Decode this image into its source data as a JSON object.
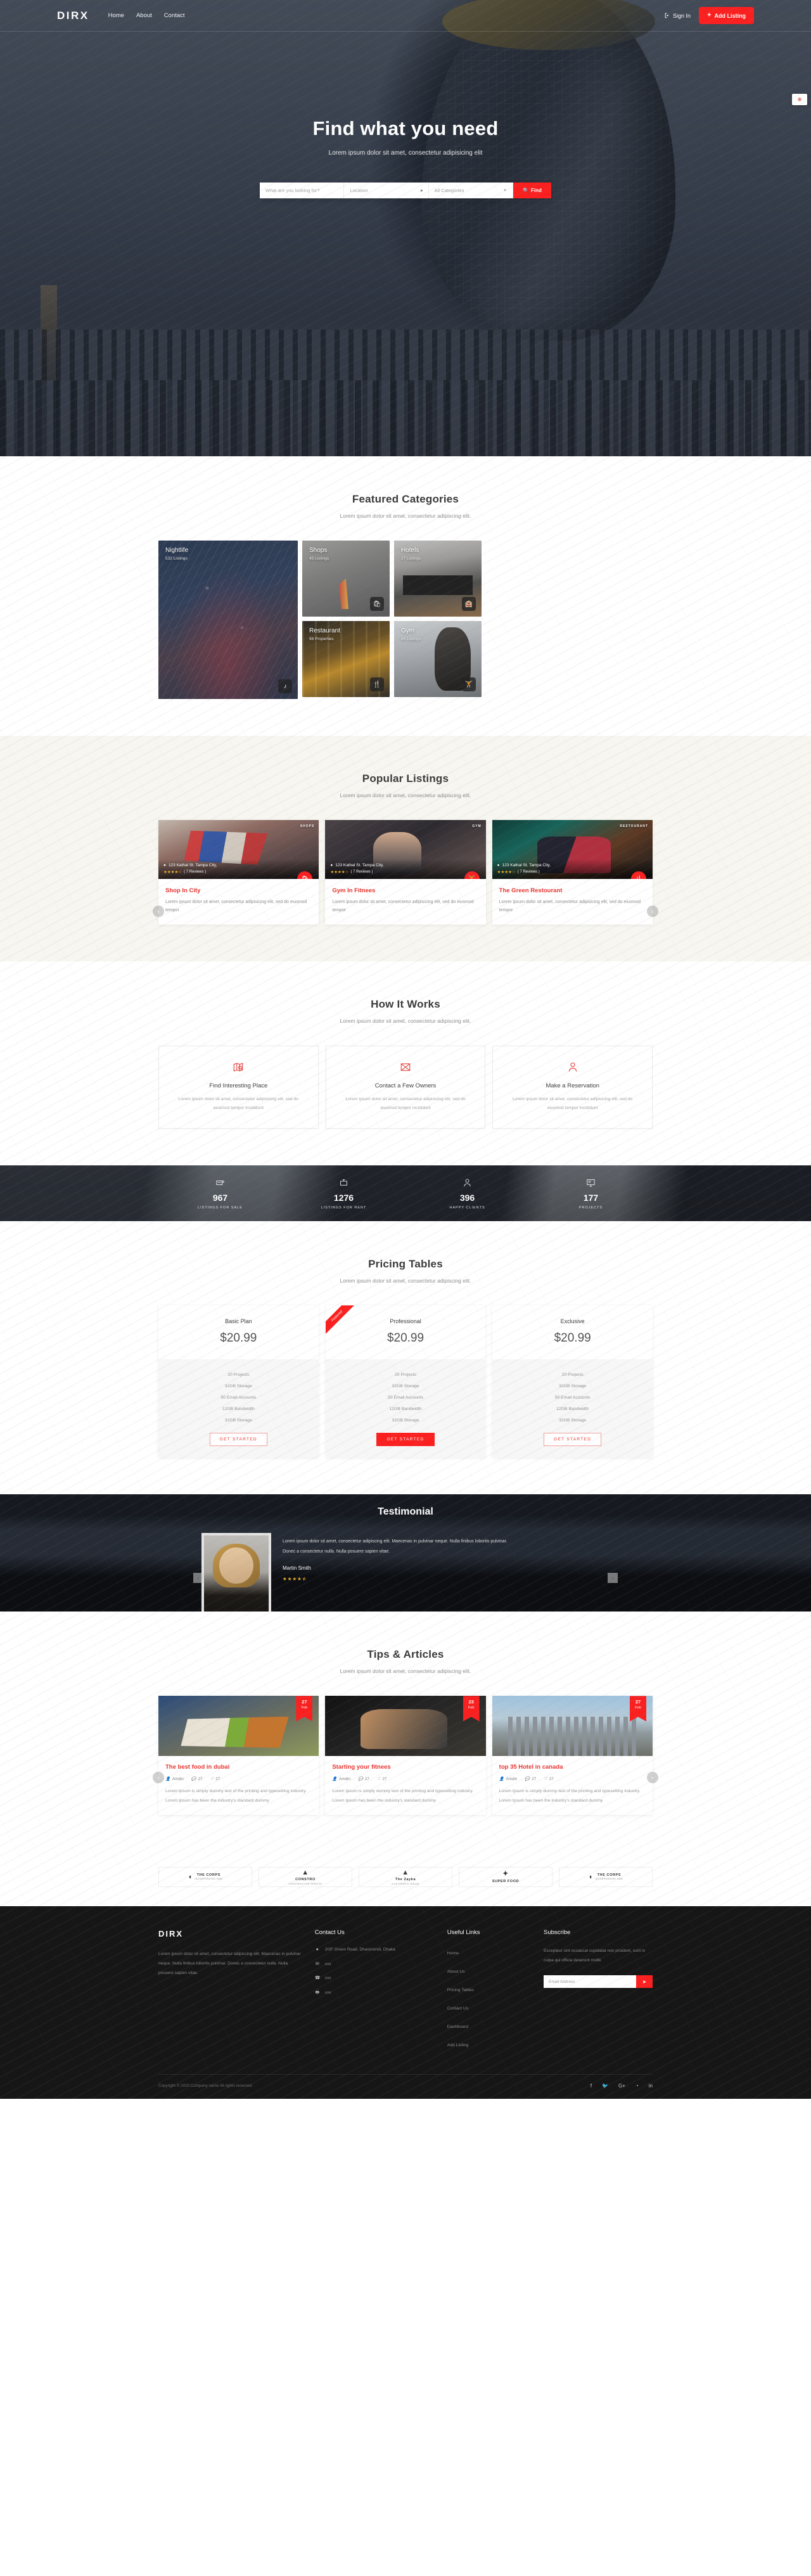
{
  "nav": {
    "logo": "DIRX",
    "links": [
      "Home",
      "About",
      "Contact"
    ],
    "sign_in": "Sign In",
    "add_listing": "Add Listing"
  },
  "hero": {
    "title": "Find what you need",
    "subtitle": "Lorem ipsum dolor sit amet, consectetur adipisicing elit",
    "search_placeholder": "What are you looking for?",
    "location_placeholder": "Location",
    "category_value": "All Categories",
    "find_label": "Find"
  },
  "featured": {
    "title": "Featured Categories",
    "subtitle": "Lorem ipsum dolor sit amet, consectetur adipiscing elit.",
    "items": [
      {
        "name": "Nightlife",
        "count": "532 Listings",
        "icon": "music-icon"
      },
      {
        "name": "Shops",
        "count": "45 Listings",
        "icon": "shopping-bag-icon"
      },
      {
        "name": "Hotels",
        "count": "27 Listings",
        "icon": "hotel-icon"
      },
      {
        "name": "Restaurant",
        "count": "98 Properties",
        "icon": "restaurant-icon"
      },
      {
        "name": "Gym",
        "count": "85 Listings",
        "icon": "gym-icon"
      }
    ]
  },
  "popular": {
    "title": "Popular Listings",
    "subtitle": "Lorem ipsum dolor sit amet, consectetur adipiscing elit.",
    "prev": "‹",
    "next": "›",
    "items": [
      {
        "tag": "SHOPS",
        "address": "123 Kathal St. Tampa City,",
        "stars": "★★★★☆",
        "reviews": "( 7 Reviews )",
        "title": "Shop In City",
        "desc": "Lorem ipsum dolor sit amet, consectetur adipisicing elit, sed do eiusmod tempor",
        "badge_icon": "shopping-bag-icon"
      },
      {
        "tag": "GYM",
        "address": "123 Kathal St. Tampa City,",
        "stars": "★★★★☆",
        "reviews": "( 7 Reviews )",
        "title": "Gym In Fitnees",
        "desc": "Lorem ipsum dolor sit amet, consectetur adipisicing elit, sed do eiusmod tempor",
        "badge_icon": "gym-icon"
      },
      {
        "tag": "RESTOURANT",
        "address": "123 Kathal St. Tampa City,",
        "stars": "★★★★☆",
        "reviews": "( 7 Reviews )",
        "title": "The Green Restourant",
        "desc": "Lorem ipsum dolor sit amet, consectetur adipisicing elit, sed do eiusmod tempor",
        "badge_icon": "restaurant-icon"
      }
    ]
  },
  "how": {
    "title": "How It Works",
    "subtitle": "Lorem ipsum dolor sit amet, consectetur adipiscing elit.",
    "items": [
      {
        "title": "Find Interesting Place",
        "desc": "Lorem ipsum dolor sit amet, consectetur adipisicing elit, sed do eiusmod tempor incididunt",
        "icon": "map-search-icon"
      },
      {
        "title": "Contact a Few Owners",
        "desc": "Lorem ipsum dolor sit amet, consectetur adipisicing elit, sed do eiusmod tempor incididunt",
        "icon": "envelope-icon"
      },
      {
        "title": "Make a Reservation",
        "desc": "Lorem ipsum dolor sit amet, consectetur adipisicing elit, sed do eiusmod tempor incididunt",
        "icon": "user-icon"
      }
    ]
  },
  "counters": [
    {
      "value": "967",
      "label": "LISTINGS FOR SALE",
      "icon": "sale-tag-icon"
    },
    {
      "value": "1276",
      "label": "LISTINGS FOR RENT",
      "icon": "rent-sign-icon"
    },
    {
      "value": "396",
      "label": "HAPPY CLIENTS",
      "icon": "user-icon"
    },
    {
      "value": "177",
      "label": "PROJECTS",
      "icon": "monitor-icon"
    }
  ],
  "pricing": {
    "title": "Pricing Tables",
    "subtitle": "Lorem ipsum dolor sit amet, consectetur adipiscing elit.",
    "ribbon": "Featured",
    "plans": [
      {
        "name": "Basic Plan",
        "price": "$20.99",
        "featured": false,
        "cta": "GET STARTED",
        "features": [
          "20 Projects",
          "32GB Storage",
          "50 Email Accounts",
          "12GB Bandwidth",
          "32GB Storage"
        ]
      },
      {
        "name": "Professional",
        "price": "$20.99",
        "featured": true,
        "cta": "GET STARTED",
        "features": [
          "20 Projects",
          "32GB Storage",
          "50 Email Accounts",
          "12GB Bandwidth",
          "32GB Storage"
        ]
      },
      {
        "name": "Exclusive",
        "price": "$20.99",
        "featured": false,
        "cta": "GET STARTED",
        "features": [
          "20 Projects",
          "32GB Storage",
          "50 Email Accounts",
          "12GB Bandwidth",
          "32GB Storage"
        ]
      }
    ]
  },
  "testimonial": {
    "title": "Testimonial",
    "quote": "Lorem ipsum dolor sit amet, consectetur adipiscing elit. Maecenas in pulvinar neque. Nulla finibus lobortis pulvinar. Donec a consectetur nulla. Nulla posuere sapien vitae.",
    "name": "Martin Smith",
    "stars": "★★★★⯪",
    "prev": "‹",
    "next": "›"
  },
  "tips": {
    "title": "Tips & Articles",
    "subtitle": "Lorem ipsum dolor sit amet, consectetur adipiscing elit.",
    "prev": "‹",
    "next": "›",
    "items": [
      {
        "day": "27",
        "month": "Feb",
        "title": "The best food in dubai",
        "author": "Amdin",
        "comments": "27",
        "likes": "27",
        "desc": "Lorem Ipsum is simply dummy text of the printing and typesetting industry. Lorem Ipsum has been the industry's standard dummy"
      },
      {
        "day": "23",
        "month": "Feb",
        "title": "Starting your fitnees",
        "author": "Amdin",
        "comments": "27",
        "likes": "27",
        "desc": "Lorem Ipsum is simply dummy text of the printing and typesetting industry. Lorem Ipsum has been the industry's standard dummy"
      },
      {
        "day": "27",
        "month": "Feb",
        "title": "top 35 Hotel in canada",
        "author": "Amdin",
        "comments": "27",
        "likes": "27",
        "desc": "Lorem Ipsum is simply dummy text of the printing and typesetting industry. Lorem Ipsum has been the industry's standard dummy"
      }
    ]
  },
  "brands": [
    {
      "name": "THE CORPS",
      "sub": "INCORPORATED 1880",
      "mark": "◖"
    },
    {
      "name": "CONSTRO",
      "sub": "CONSTRUCTION SERVICE",
      "mark": "▲"
    },
    {
      "name": "The Zayka",
      "sub": "A AUTHENTIC INDIAN",
      "mark": "▲"
    },
    {
      "name": "SUPER FOOD",
      "sub": "",
      "mark": "✦"
    },
    {
      "name": "THE CORPS",
      "sub": "INCORPORATED 1880",
      "mark": "◖"
    }
  ],
  "footer": {
    "logo": "DIRX",
    "about": "Lorem ipsum dolor sit amet, consectetur adipiscing elit. Maecenas in pulvinar neque. Nulla finibus lobortis pulvinar. Donec a consectetur nulla. Nulla posuere sapien vitae.",
    "contact_title": "Contact Us",
    "contact": [
      {
        "icon": "location-pin-icon",
        "text": "20/F Green Road, Dhanmondi, Dhaka"
      },
      {
        "icon": "mail-icon",
        "text": "xxx"
      },
      {
        "icon": "phone-icon",
        "text": "xxx"
      },
      {
        "icon": "print-icon",
        "text": "xxx"
      }
    ],
    "links_title": "Useful Links",
    "links": [
      "Home",
      "About Us",
      "Pricing Tables",
      "Contact Us",
      "Dashboard",
      "Add Listing"
    ],
    "subscribe_title": "Subscribe",
    "subscribe_text": "Excepteur sint occaecat cupidatat non proident, sunt in culpa qui officia deserunt mollit.",
    "email_placeholder": "Email Address",
    "copyright": "Copyright © 2020 Company name All rights reserved.",
    "socials": [
      "f",
      "🐦",
      "G+",
      "◔",
      "in"
    ]
  },
  "colors": {
    "accent": "#fb2020",
    "accent_dark": "#e8342f",
    "dark": "#161616",
    "cream": "#f7f6f1"
  }
}
